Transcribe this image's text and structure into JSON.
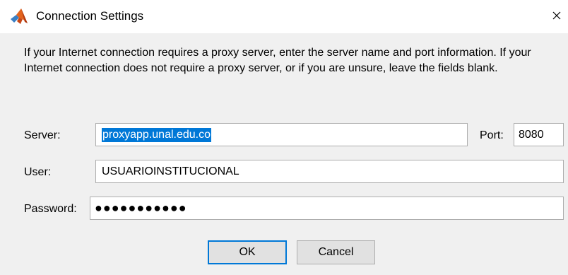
{
  "window": {
    "title": "Connection Settings",
    "close_glyph": "×"
  },
  "description": "If your Internet connection requires a proxy server, enter the server name and port information. If your Internet connection does not require a proxy server, or if you are unsure, leave the fields blank.",
  "form": {
    "server_label": "Server:",
    "server_value": "proxyapp.unal.edu.co",
    "port_label": "Port:",
    "port_value": "8080",
    "user_label": "User:",
    "user_value": "USUARIOINSTITUCIONAL",
    "password_label": "Password:",
    "password_mask": "●●●●●●●●●●●"
  },
  "buttons": {
    "ok_label": "OK",
    "cancel_label": "Cancel"
  },
  "icons": {
    "app": "matlab-logo-icon",
    "close": "close-icon"
  },
  "colors": {
    "selection": "#0078d7",
    "dialog_background": "#f0f0f0",
    "button_face": "#e1e1e1",
    "default_button_border": "#0078d7"
  }
}
